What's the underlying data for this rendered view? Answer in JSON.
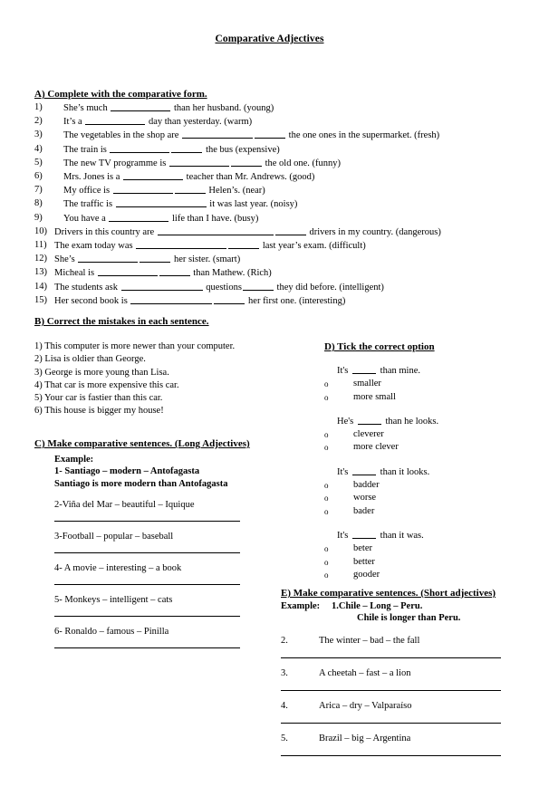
{
  "document": {
    "title": "Comparative Adjectives"
  },
  "section_a": {
    "heading": "A) Complete with the comparative form.",
    "items": [
      {
        "num": "1)",
        "before": "She’s much",
        "blank1": 66,
        "after": "than her husband. (young)"
      },
      {
        "num": "2)",
        "before": "It’s a",
        "blank1": 66,
        "after": "day than yesterday. (warm)"
      },
      {
        "num": "3)",
        "before": "The vegetables in the shop are",
        "blank1": 78,
        "blank2": 34,
        "after": "the one ones in the supermarket. (fresh)"
      },
      {
        "num": "4)",
        "before": "The train is",
        "blank1": 66,
        "blank2": 34,
        "after": "the bus (expensive)"
      },
      {
        "num": "5)",
        "before": "The new TV programme is",
        "blank1": 66,
        "blank2": 34,
        "after": "the old one. (funny)"
      },
      {
        "num": "6)",
        "before": "Mrs. Jones is a",
        "blank1": 66,
        "after": "teacher than Mr. Andrews. (good)"
      },
      {
        "num": "7)",
        "before": "My office is",
        "blank1": 66,
        "blank2": 34,
        "after": "Helen’s. (near)"
      },
      {
        "num": "8)",
        "before": "The traffic is",
        "blank1": 100,
        "after": "it was last year. (noisy)"
      },
      {
        "num": "9)",
        "before": "You have a",
        "blank1": 66,
        "after": "life than I have. (busy)"
      },
      {
        "num": "10)",
        "before": "Drivers in this country are",
        "blank1": 128,
        "blank2": 34,
        "after": "drivers in my country. (dangerous)"
      },
      {
        "num": "11)",
        "before": "The exam today was",
        "blank1": 100,
        "blank2": 34,
        "after": "last year’s exam. (difficult)"
      },
      {
        "num": "12)",
        "before": "She’s",
        "blank1": 66,
        "blank2": 34,
        "after": "her sister. (smart)"
      },
      {
        "num": "13)",
        "before": "Micheal is",
        "blank1": 66,
        "blank2": 34,
        "after": "than Mathew. (Rich)"
      },
      {
        "num": "14)",
        "before": "The students ask",
        "blank1": 90,
        "after": "questions",
        "blank2": 34,
        "tail": "they did before. (intelligent)"
      },
      {
        "num": "15)",
        "before": "Her second book is",
        "blank1": 90,
        "blank2": 34,
        "after": "her first one. (interesting)"
      }
    ]
  },
  "section_b": {
    "heading": "B) Correct the mistakes in each sentence.",
    "items": [
      "1) This computer  is more newer than your computer.",
      "2) Lisa is oldier than George.",
      "3) George is more young  than Lisa.",
      "4) That car is more expensive  this car.",
      "5) Your car is fastier  than this car.",
      "6) This house is bigger my house!"
    ]
  },
  "section_c": {
    "heading": "C) Make comparative sentences. (Long Adjectives)",
    "example_label": "Example:",
    "example_prompt": "1- Santiago – modern – Antofagasta",
    "example_answer": "Santiago is more modern than Antofagasta",
    "items": [
      "2-Viña del Mar – beautiful – Iquique",
      "3-Football – popular – baseball",
      "4- A movie – interesting – a book",
      "5- Monkeys – intelligent – cats",
      "6- Ronaldo – famous – Pinilla"
    ]
  },
  "section_d": {
    "heading": "D) Tick the correct option",
    "bullet": "o",
    "groups": [
      {
        "stem_before": "It's",
        "stem_after": "than mine.",
        "options": [
          "smaller",
          "more small"
        ]
      },
      {
        "stem_before": "He's",
        "stem_after": "than he looks.",
        "options": [
          "cleverer",
          "more clever"
        ]
      },
      {
        "stem_before": "It's",
        "stem_after": "than it looks.",
        "options": [
          "badder",
          "worse",
          "bader"
        ]
      },
      {
        "stem_before": "It's",
        "stem_after": "than it was.",
        "options": [
          "beter",
          "better",
          "gooder"
        ]
      }
    ]
  },
  "section_e": {
    "heading": "E) Make comparative sentences. (Short adjectives)",
    "example_label": "Example:",
    "example_prompt": "1.Chile – Long – Peru.",
    "example_answer": "Chile is longer than Peru.",
    "items": [
      {
        "num": "2.",
        "text": "The winter – bad – the fall"
      },
      {
        "num": "3.",
        "text": "A cheetah – fast – a lion"
      },
      {
        "num": "4.",
        "text": "Arica – dry – Valparaíso"
      },
      {
        "num": "5.",
        "text": "Brazil – big – Argentina"
      }
    ]
  }
}
